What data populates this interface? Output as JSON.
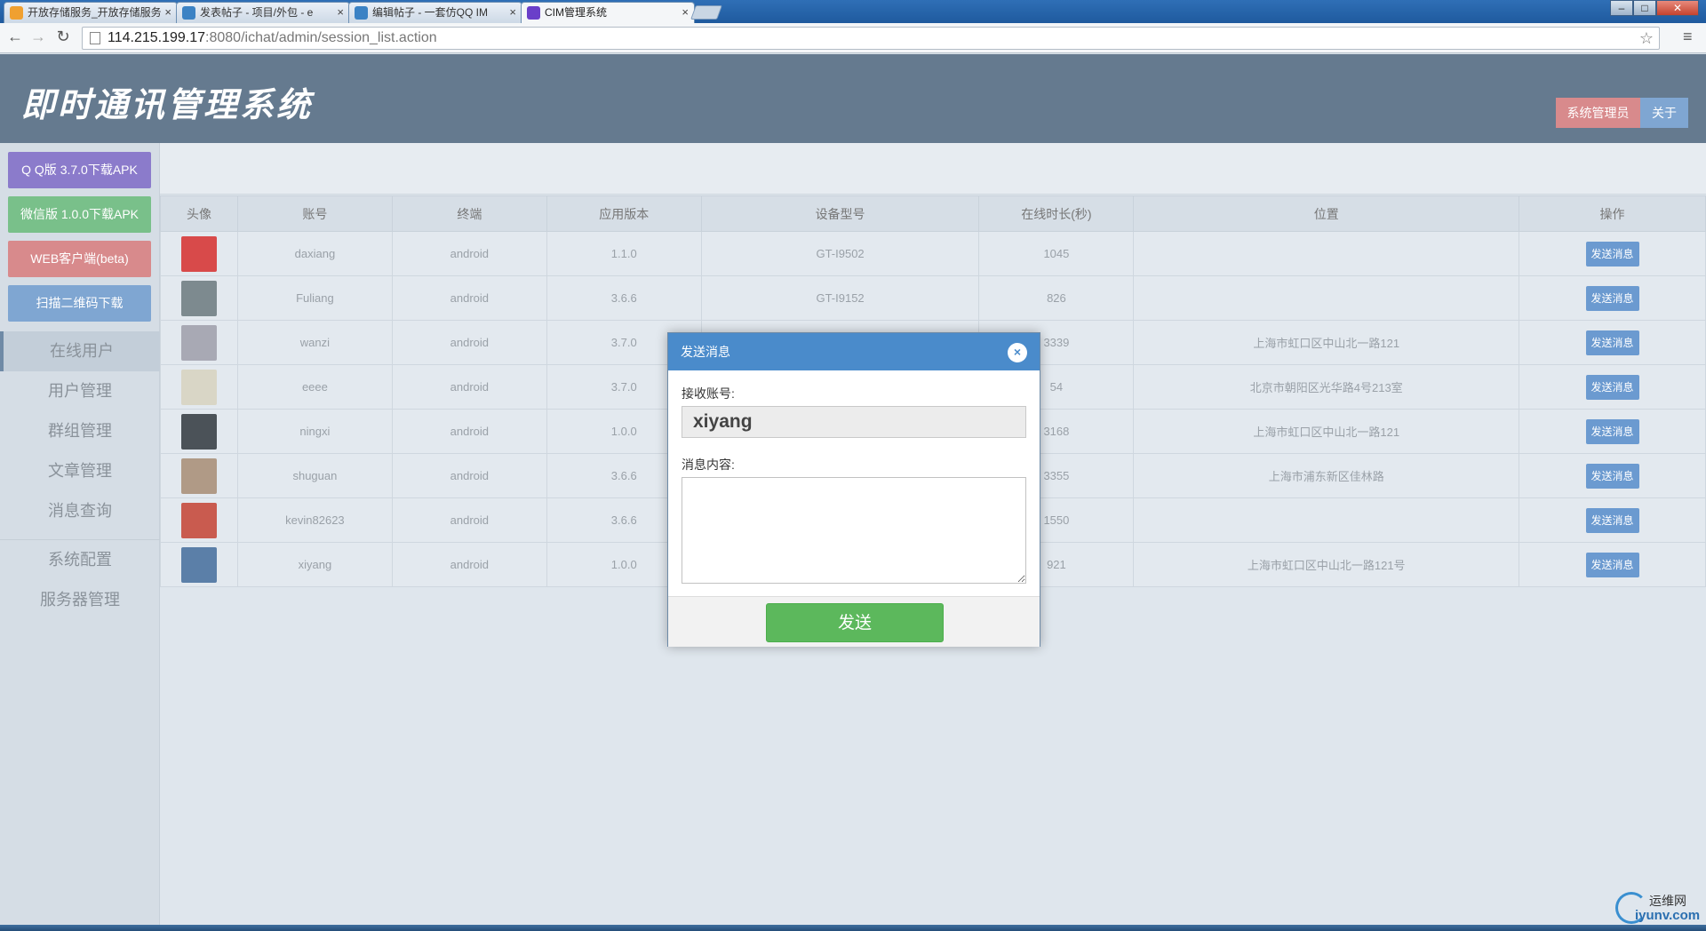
{
  "browser": {
    "tabs": [
      {
        "label": "开放存储服务_开放存储服务",
        "icon": "storage-favicon",
        "color": "#f0a030",
        "active": false
      },
      {
        "label": "发表帖子 - 项目/外包 - e",
        "icon": "forum-favicon",
        "color": "#3b82c4",
        "active": false
      },
      {
        "label": "编辑帖子 - 一套仿QQ IM",
        "icon": "forum-favicon",
        "color": "#3b82c4",
        "active": false
      },
      {
        "label": "CIM管理系统",
        "icon": "cim-favicon",
        "color": "#6a3fc9",
        "active": true
      }
    ],
    "url_host": "114.215.199.17",
    "url_rest": ":8080/ichat/admin/session_list.action"
  },
  "header": {
    "title": "即时通讯管理系统",
    "admin_label": "系统管理员",
    "about_label": "关于"
  },
  "sidebar": {
    "download_buttons": [
      {
        "label": "Q Q版 3.7.0下载APK",
        "color": "#8b7bcb"
      },
      {
        "label": "微信版 1.0.0下载APK",
        "color": "#79c08a"
      },
      {
        "label": "WEB客户端(beta)",
        "color": "#d88a8c"
      },
      {
        "label": "扫描二维码下载",
        "color": "#7fa6d2"
      }
    ],
    "menu": [
      {
        "label": "在线用户",
        "active": true
      },
      {
        "label": "用户管理",
        "active": false
      },
      {
        "label": "群组管理",
        "active": false
      },
      {
        "label": "文章管理",
        "active": false
      },
      {
        "label": "消息查询",
        "active": false
      },
      {
        "label": "系统配置",
        "active": false
      },
      {
        "label": "服务器管理",
        "active": false
      }
    ]
  },
  "table": {
    "columns": [
      "头像",
      "账号",
      "终端",
      "应用版本",
      "设备型号",
      "在线时长(秒)",
      "位置",
      "操作"
    ],
    "action_label": "发送消息",
    "rows": [
      {
        "account": "daxiang",
        "terminal": "android",
        "version": "1.1.0",
        "device": "GT-I9502",
        "online": "1045",
        "location": "",
        "avatar_color": "#d84a4a"
      },
      {
        "account": "Fuliang",
        "terminal": "android",
        "version": "3.6.6",
        "device": "GT-I9152",
        "online": "826",
        "location": "",
        "avatar_color": "#7d8a8f"
      },
      {
        "account": "wanzi",
        "terminal": "android",
        "version": "3.7.0",
        "device": "",
        "online": "3339",
        "location": "上海市虹口区中山北一路121",
        "avatar_color": "#a8a9b4"
      },
      {
        "account": "eeee",
        "terminal": "android",
        "version": "3.7.0",
        "device": "",
        "online": "54",
        "location": "北京市朝阳区光华路4号213室",
        "avatar_color": "#d9d6c6"
      },
      {
        "account": "ningxi",
        "terminal": "android",
        "version": "1.0.0",
        "device": "",
        "online": "3168",
        "location": "上海市虹口区中山北一路121",
        "avatar_color": "#4b5258"
      },
      {
        "account": "shuguan",
        "terminal": "android",
        "version": "3.6.6",
        "device": "",
        "online": "3355",
        "location": "上海市浦东新区佳林路",
        "avatar_color": "#b09a86"
      },
      {
        "account": "kevin82623",
        "terminal": "android",
        "version": "3.6.6",
        "device": "",
        "online": "1550",
        "location": "",
        "avatar_color": "#c95b4f"
      },
      {
        "account": "xiyang",
        "terminal": "android",
        "version": "1.0.0",
        "device": "",
        "online": "921",
        "location": "上海市虹口区中山北一路121号",
        "avatar_color": "#5b7fa8"
      }
    ]
  },
  "modal": {
    "title": "发送消息",
    "receiver_label": "接收账号:",
    "receiver_value": "xiyang",
    "content_label": "消息内容:",
    "content_value": "",
    "submit_label": "发送"
  },
  "watermark": {
    "cn": "运维网",
    "en": "iyunv.com"
  }
}
